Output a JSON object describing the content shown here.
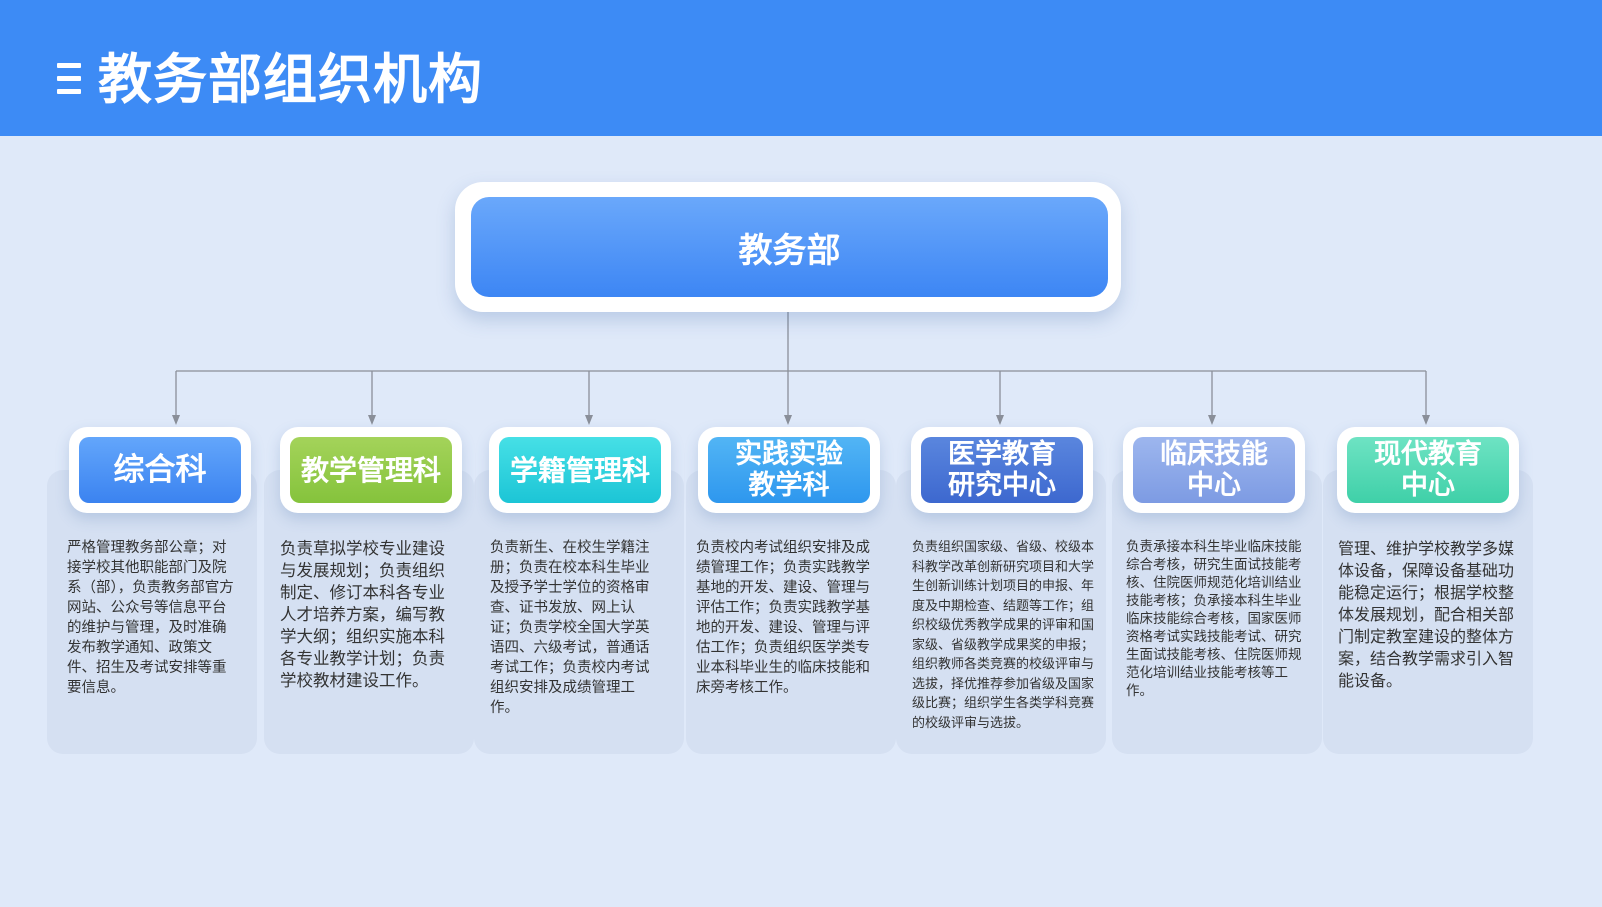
{
  "page": {
    "title": "教务部组织机构"
  },
  "root": {
    "label": "教务部"
  },
  "departments": [
    {
      "name": "综合科",
      "desc": "严格管理教务部公章；对接学校其他职能部门及院系（部），负责教务部官方网站、公众号等信息平台的维护与管理，及时准确发布教学通知、政策文件、招生及考试安排等重要信息。",
      "color_top": "#63a6fb",
      "color_bottom": "#3b83f0"
    },
    {
      "name": "教学管理科",
      "desc": "负责草拟学校专业建设与发展规划；负责组织制定、修订本科各专业人才培养方案，编写教学大纲；组织实施本科各专业教学计划；负责学校教材建设工作。",
      "color_top": "#a4d35a",
      "color_bottom": "#85c33c"
    },
    {
      "name": "学籍管理科",
      "desc": "负责新生、在校生学籍注册；负责在校本科生毕业及授予学士学位的资格审查、证书发放、网上认证；负责学校全国大学英语四、六级考试，普通话考试工作；负责校内考试组织安排及成绩管理工作。",
      "color_top": "#46e0e6",
      "color_bottom": "#1cc5d6"
    },
    {
      "name": "实践实验教学科",
      "desc": "负责校内考试组织安排及成绩管理工作；负责实践教学基地的开发、建设、管理与评估工作；负责实践教学基地的开发、建设、管理与评估工作；负责组织医学类专业本科毕业生的临床技能和床旁考核工作。",
      "color_top": "#52b5f5",
      "color_bottom": "#2e97ee"
    },
    {
      "name": "医学教育研究中心",
      "desc": "负责组织国家级、省级、校级本科教学改革创新研究项目和大学生创新训练计划项目的申报、年度及中期检查、结题等工作；组织校级优秀教学成果的评审和国家级、省级教学成果奖的申报；组织教师各类竞赛的校级评审与选拔，择优推荐参加省级及国家级比赛；组织学生各类学科竞赛的校级评审与选拔。",
      "color_top": "#5a86de",
      "color_bottom": "#3d68cf"
    },
    {
      "name": "临床技能中心",
      "desc": "负责承接本科生毕业临床技能综合考核，研究生面试技能考核、住院医师规范化培训结业技能考核；负承接本科生毕业临床技能综合考核，国家医师资格考试实践技能考试、研究生面试技能考核、住院医师规范化培训结业技能考核等工作。",
      "color_top": "#9db6ee",
      "color_bottom": "#7d9be3"
    },
    {
      "name": "现代教育中心",
      "desc": "管理、维护学校教学多媒体设备，保障设备基础功能稳定运行；根据学校整体发展规划，配合相关部门制定教室建设的整体方案，结合教学需求引入智能设备。",
      "color_top": "#6ee3c3",
      "color_bottom": "#3fd0a8"
    }
  ],
  "colors": {
    "header": "#3d8bf5",
    "background": "#dfe9f9",
    "connector": "#8a8f99"
  }
}
